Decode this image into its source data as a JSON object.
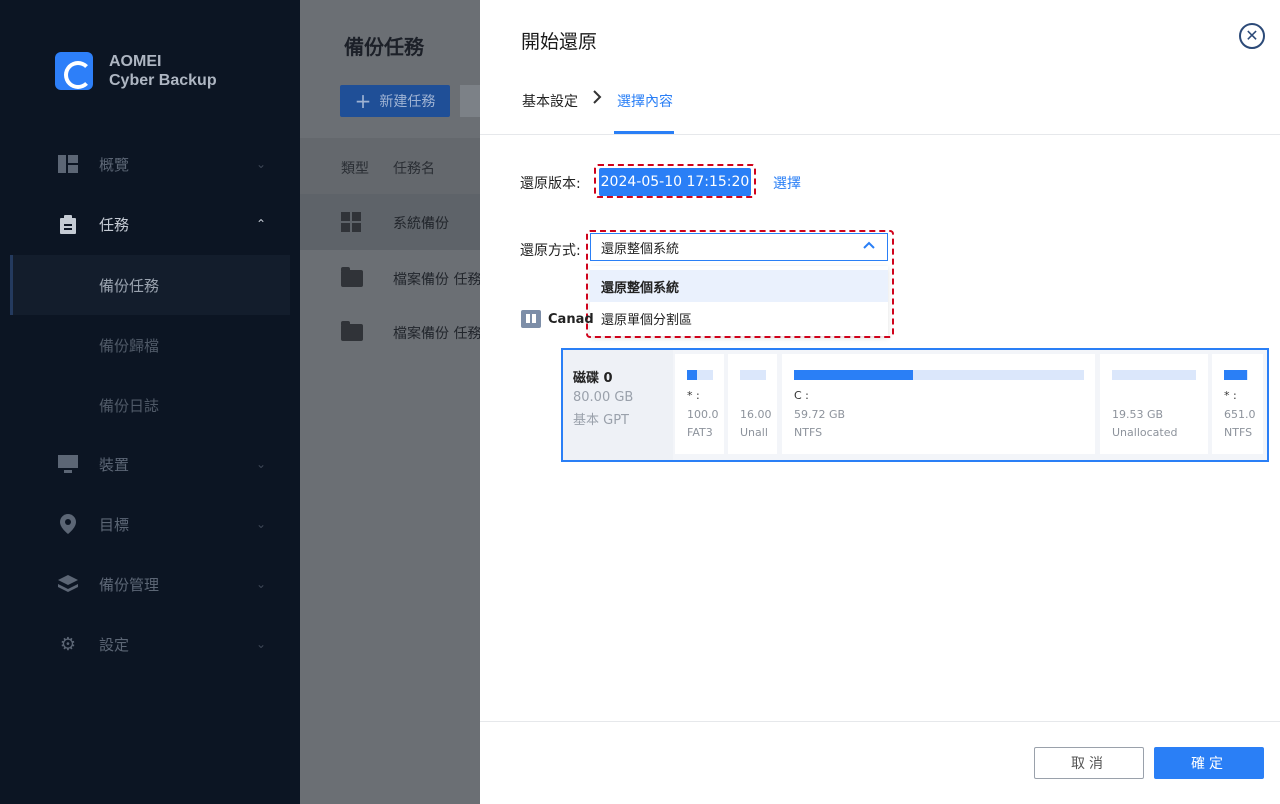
{
  "app": {
    "brand_line1": "AOMEI",
    "brand_line2": "Cyber Backup"
  },
  "sidebar": {
    "items": [
      {
        "label": "概覽",
        "icon": "dashboard-icon"
      },
      {
        "label": "任務",
        "icon": "clipboard-icon"
      },
      {
        "label": "備份任務"
      },
      {
        "label": "備份歸檔"
      },
      {
        "label": "備份日誌"
      },
      {
        "label": "裝置",
        "icon": "monitor-icon"
      },
      {
        "label": "目標",
        "icon": "location-pin-icon"
      },
      {
        "label": "備份管理",
        "icon": "layers-icon"
      },
      {
        "label": "設定",
        "icon": "gear-icon"
      }
    ]
  },
  "main": {
    "title": "備份任務",
    "new_task_label": "新建任務",
    "columns": [
      "類型",
      "任務名"
    ],
    "rows": [
      {
        "type_icon": "windows-icon",
        "name": "系統備份"
      },
      {
        "type_icon": "folder-icon",
        "name": "檔案備份 任務"
      },
      {
        "type_icon": "folder-icon",
        "name": "檔案備份 任務"
      }
    ]
  },
  "dialog": {
    "title": "開始還原",
    "breadcrumb": [
      "基本設定",
      "選擇內容"
    ],
    "version_label": "還原版本:",
    "version_value": "2024-05-10 17:15:20",
    "select_link": "選擇",
    "method_label": "還原方式:",
    "method_value": "還原整個系統",
    "method_options": [
      "還原整個系統",
      "還原單個分割區"
    ],
    "computer_name": "Canad",
    "disk": {
      "name": "磁碟 0",
      "size": "80.00 GB",
      "type": "基本 GPT",
      "partitions": [
        {
          "letter": "* :",
          "size": "100.0",
          "fs": "FAT3",
          "used": 0.4
        },
        {
          "letter": "",
          "size": "16.00",
          "fs": "Unall",
          "used": 0
        },
        {
          "letter": "C :",
          "size": "59.72 GB",
          "fs": "NTFS",
          "used": 0.41
        },
        {
          "letter": "",
          "size": "19.53 GB",
          "fs": "Unallocated",
          "used": 0
        },
        {
          "letter": "* :",
          "size": "651.0",
          "fs": "NTFS",
          "used": 0.95
        }
      ]
    },
    "cancel_label": "取消",
    "ok_label": "確定"
  },
  "colors": {
    "accent": "#2a7ff6",
    "highlight_dash": "#d0021b",
    "sidebar_bg": "#0c1523"
  }
}
